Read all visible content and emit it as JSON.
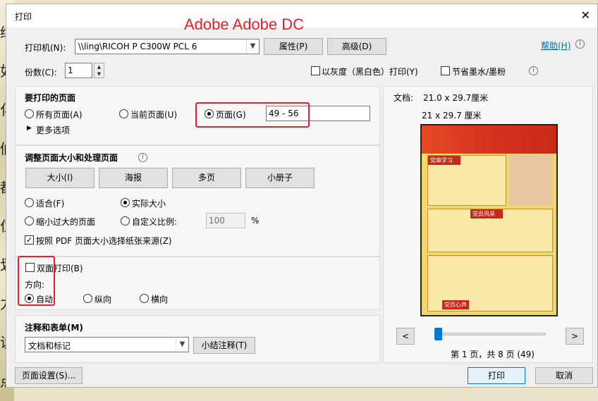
{
  "background": {
    "left_glyphs": [
      "缉",
      "如",
      "化",
      "们",
      "都",
      "位",
      "划",
      "力",
      "说",
      "点"
    ]
  },
  "window": {
    "title": "打印",
    "overlay_title": "Adobe Adobe DC"
  },
  "printer": {
    "label": "打印机(N):",
    "value": "\\\\ling\\RICOH P C300W PCL 6",
    "properties_label": "属性(P)",
    "advanced_label": "高级(D)"
  },
  "help": {
    "label": "帮助(H)"
  },
  "copies": {
    "label": "份数(C):",
    "value": "1"
  },
  "options": {
    "grayscale_label": "以灰度（黑白色）打印(Y)",
    "save_ink_label": "节省墨水/墨粉"
  },
  "pages_to_print": {
    "title": "要打印的页面",
    "all_label": "所有页面(A)",
    "current_label": "当前页面(U)",
    "pages_label": "页面(G)",
    "pages_value": "49 - 56",
    "more_label": "更多选项",
    "selected": "pages"
  },
  "sizing": {
    "title": "调整页面大小和处理页面",
    "tabs": [
      "大小(I)",
      "海报",
      "多页",
      "小册子"
    ],
    "fit_label": "适合(F)",
    "actual_label": "实际大小",
    "shrink_label": "缩小过大的页面",
    "custom_label": "自定义比例:",
    "custom_value": "100",
    "percent": "%",
    "paper_source_label": "按照 PDF 页面大小选择纸张来源(Z)",
    "duplex_label": "双面打印(B)",
    "selected": "actual"
  },
  "orientation": {
    "title": "方向:",
    "auto_label": "自动",
    "portrait_label": "纵向",
    "landscape_label": "横向",
    "selected": "auto"
  },
  "comments": {
    "title": "注释和表单(M)",
    "value": "文档和标记",
    "summarize_label": "小结注释(T)"
  },
  "preview": {
    "doc_label": "文档:",
    "doc_size": "21.0 x 29.7厘米",
    "paper_size": "21 x 29.7 厘米",
    "page_status": "第 1 页，共 8 页 (49)",
    "headline_1": "党章学习",
    "headline_2": "党员风采",
    "headline_3": "党员心声"
  },
  "footer": {
    "page_setup_label": "页面设置(S)...",
    "print_label": "打印",
    "cancel_label": "取消"
  }
}
